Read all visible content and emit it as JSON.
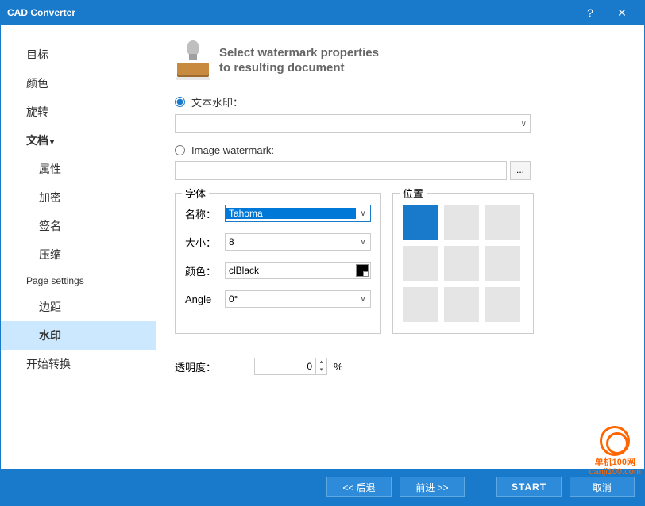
{
  "window": {
    "title": "CAD Converter"
  },
  "sidebar": {
    "items": [
      {
        "label": "目标"
      },
      {
        "label": "颜色"
      },
      {
        "label": "旋转"
      },
      {
        "label": "文档"
      },
      {
        "label": "属性"
      },
      {
        "label": "加密"
      },
      {
        "label": "签名"
      },
      {
        "label": "压缩"
      },
      {
        "label": "Page settings"
      },
      {
        "label": "边距"
      },
      {
        "label": "水印"
      },
      {
        "label": "开始转换"
      }
    ]
  },
  "header": {
    "line1": "Select watermark properties",
    "line2": "to resulting document"
  },
  "radios": {
    "text": "文本水印：",
    "image": "Image watermark:"
  },
  "font": {
    "legend": "字体",
    "name_label": "名称：",
    "name_value": "Tahoma",
    "size_label": "大小：",
    "size_value": "8",
    "color_label": "颜色：",
    "color_value": "clBlack",
    "angle_label": "Angle",
    "angle_value": "0°"
  },
  "position": {
    "legend": "位置"
  },
  "opacity": {
    "label": "透明度：",
    "value": "0",
    "unit": "%"
  },
  "footer": {
    "back": "<< 后退",
    "next": "前进 >>",
    "start": "START",
    "cancel": "取消"
  },
  "browse": "...",
  "logo": {
    "text": "单机100网",
    "url": "danji100.com"
  }
}
